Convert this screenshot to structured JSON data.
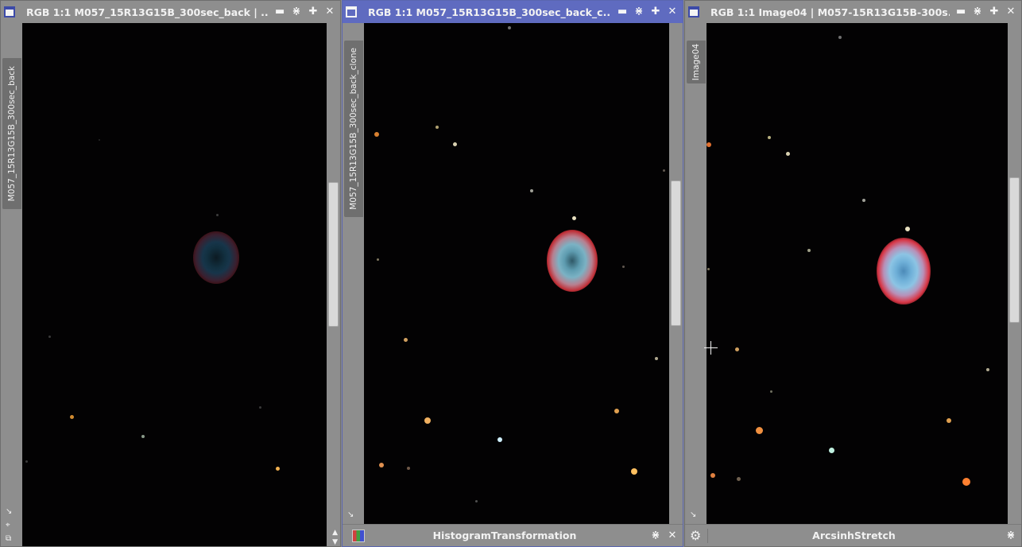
{
  "windows": [
    {
      "title": "RGB 1:1 M057_15R13G15B_300sec_back | ...",
      "tab_label": "M057_15R13G15B_300sec_back"
    },
    {
      "title": "RGB 1:1 M057_15R13G15B_300sec_back_c...",
      "tab_label": "M057_15R13G15B_300sec_back_clone",
      "panel_title": "HistogramTransformation"
    },
    {
      "title": "RGB 1:1 Image04 | M057-15R13G15B-300s...",
      "tab_label": "Image04",
      "panel_title": "ArcsinhStretch"
    }
  ],
  "icons": {
    "window": "window-icon",
    "minimize": "minimize-icon",
    "shade": "shade-icon",
    "maximize": "maximize-icon",
    "close": "close-icon",
    "histogram": "histogram-icon",
    "settings": "gear-icon",
    "crosshair": "crosshair-cursor-icon"
  },
  "colors": {
    "active_titlebar": "#5f6bc0",
    "inactive_titlebar": "#8e8e8e",
    "image_background": "#030203"
  }
}
